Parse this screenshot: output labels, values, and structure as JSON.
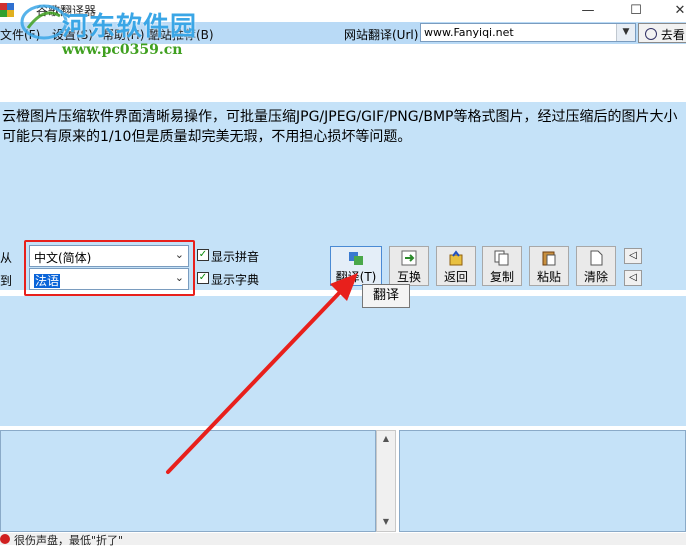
{
  "window": {
    "title": "谷歌翻译器",
    "minimize": "—",
    "maximize": "☐",
    "close": "✕"
  },
  "watermark": {
    "brand": "河东软件园",
    "url": "www.pc0359.cn"
  },
  "menu": {
    "items": [
      "文件(F)",
      "设置(S)",
      "帮助(H)",
      "酷站推荐(B)"
    ],
    "url_label": "网站翻译(Url)",
    "url_value": "www.Fanyiqi.net",
    "goto_label": "去看"
  },
  "source": {
    "text": "云橙图片压缩软件界面清晰易操作，可批量压缩JPG/JPEG/GIF/PNG/BMP等格式图片，经过压缩后的图片大小可能只有原来的1/10但是质量却完美无瑕，不用担心损坏等问题。"
  },
  "language": {
    "from_label": "从",
    "to_label": "到",
    "from_value": "中文(简体)",
    "to_value": "法语",
    "show_pinyin": "显示拼音",
    "show_dict": "显示字典",
    "show_pinyin_checked": true,
    "show_dict_checked": true
  },
  "toolbar": {
    "translate": "翻译(T)",
    "swap": "互换",
    "back": "返回",
    "copy": "复制",
    "paste": "粘贴",
    "clear": "清除"
  },
  "tooltip": "翻译",
  "status": {
    "text": "很伤声盘，最低\"折了\""
  },
  "colors": {
    "panel": "#c5e2f8",
    "menubar": "#b9daf6",
    "highlight": "#e8201c"
  }
}
